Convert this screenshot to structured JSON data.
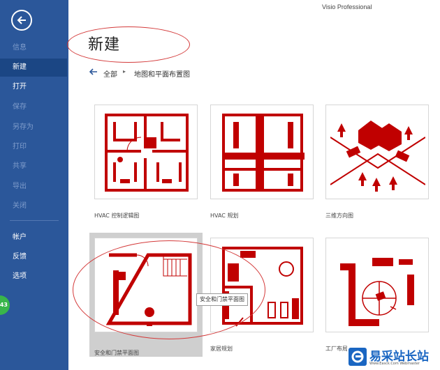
{
  "app": {
    "name": "Visio Professional"
  },
  "sidebar": {
    "items": [
      {
        "label": "信息"
      },
      {
        "label": "新建"
      },
      {
        "label": "打开"
      },
      {
        "label": "保存"
      },
      {
        "label": "另存为"
      },
      {
        "label": "打印"
      },
      {
        "label": "共享"
      },
      {
        "label": "导出"
      },
      {
        "label": "关闭"
      },
      {
        "label": "帐户"
      },
      {
        "label": "反馈"
      },
      {
        "label": "选项"
      }
    ],
    "badge": "43"
  },
  "page": {
    "title": "新建"
  },
  "breadcrumb": {
    "root": "全部",
    "separator": "▸",
    "category": "地图和平面布置图"
  },
  "templates": [
    {
      "label": "HVAC 控制逻辑图"
    },
    {
      "label": "HVAC 规划"
    },
    {
      "label": "三维方向图"
    },
    {
      "label": "安全和门禁平面图"
    },
    {
      "label": "家居规划"
    },
    {
      "label": "工厂布局"
    }
  ],
  "tooltip": "安全和门禁平面图",
  "watermark": {
    "title": "易采站长站",
    "url": "Www.Easck.Com Webmaster"
  },
  "colors": {
    "sidebar": "#2b579a",
    "active": "#1b4684",
    "icon": "#c00000",
    "annotation": "#d43a3a"
  }
}
